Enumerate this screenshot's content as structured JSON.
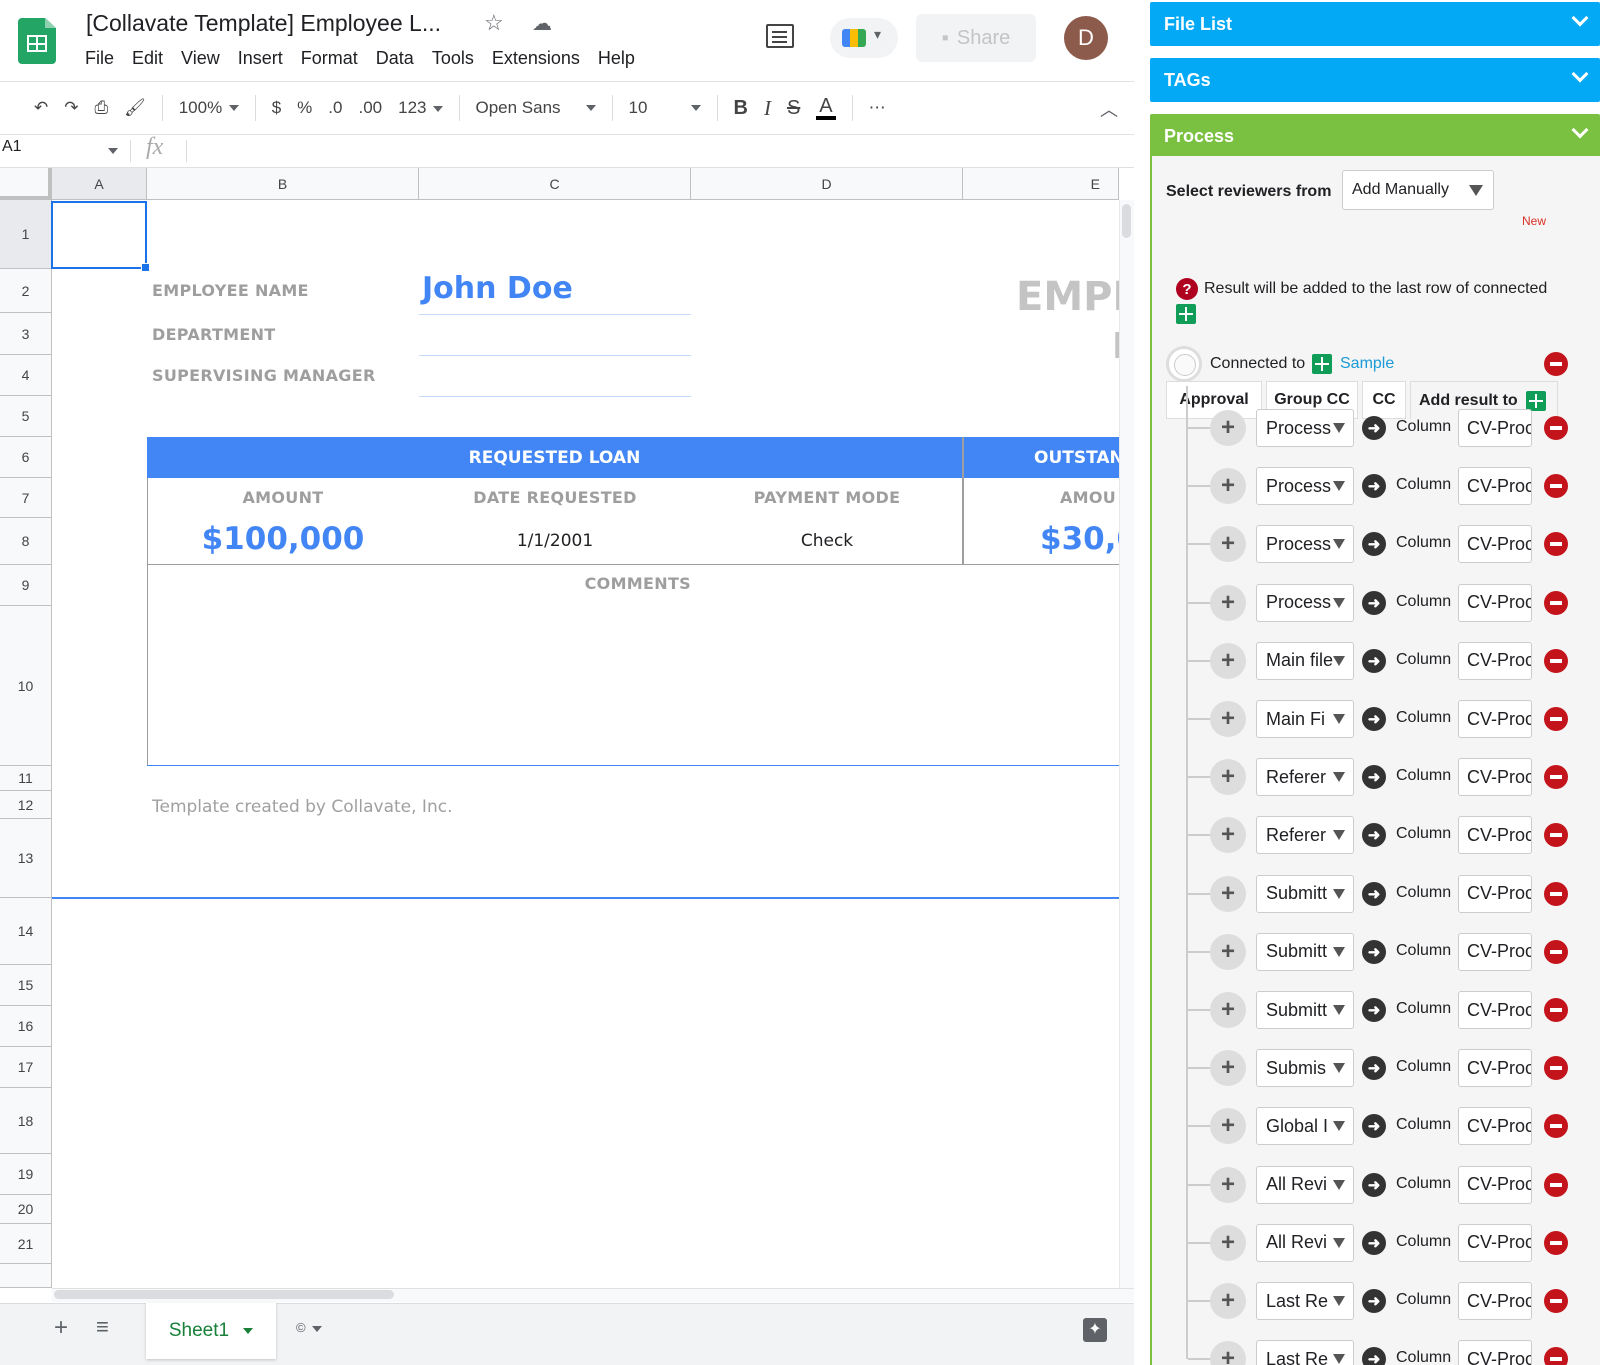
{
  "header": {
    "doc_title": "[Collavate Template] Employee L...",
    "menu": [
      "File",
      "Edit",
      "View",
      "Insert",
      "Format",
      "Data",
      "Tools",
      "Extensions",
      "Help"
    ],
    "share_label": "Share",
    "avatar_letter": "D"
  },
  "toolbar": {
    "zoom": "100%",
    "currency": "$",
    "percent": "%",
    "dec_less": ".0",
    "dec_more": ".00",
    "number_format": "123",
    "font": "Open Sans",
    "font_size": "10",
    "bold": "B",
    "italic": "I",
    "strike": "S",
    "text_color": "A",
    "more": "⋯"
  },
  "formula_bar": {
    "cell_ref": "A1",
    "fx": "fx"
  },
  "columns": [
    "A",
    "B",
    "C",
    "D",
    "E"
  ],
  "rows": [
    "1",
    "2",
    "3",
    "4",
    "5",
    "6",
    "7",
    "8",
    "9",
    "10",
    "11",
    "12",
    "13",
    "14",
    "15",
    "16",
    "17",
    "18",
    "19",
    "20",
    "21"
  ],
  "sheet": {
    "employee_name_label": "EMPLOYEE NAME",
    "employee_name": "John Doe",
    "department_label": "DEPARTMENT",
    "manager_label": "SUPERVISING MANAGER",
    "ghost_title": "EMPL",
    "ghost_sub": "I",
    "requested_loan": "REQUESTED LOAN",
    "outstanding": "OUTSTAN",
    "amount_label": "AMOUNT",
    "date_label": "DATE REQUESTED",
    "mode_label": "PAYMENT MODE",
    "amount2_label": "AMOU",
    "amount": "$100,000",
    "date": "1/1/2001",
    "mode": "Check",
    "amount2": "$30,0",
    "comments": "COMMENTS",
    "credit": "Template created by Collavate, Inc."
  },
  "bottom": {
    "sheet_tab": "Sheet1",
    "add": "+",
    "list": "≡"
  },
  "sidebar": {
    "file_list": "File List",
    "tags": "TAGs",
    "process": "Process",
    "select_reviewers_label": "Select reviewers from",
    "reviewers_value": "Add Manually",
    "tabs": [
      "Approval",
      "Group CC",
      "CC",
      "Add result to"
    ],
    "new_tag": "New",
    "result_note": "Result will be added to the last row of connected",
    "connected_label": "Connected to",
    "connected_sheet": "Sample",
    "column_word": "Column",
    "mappings": [
      {
        "field": "Process",
        "column": "CV-Proc"
      },
      {
        "field": "Process",
        "column": "CV-Proc"
      },
      {
        "field": "Process",
        "column": "CV-Proc"
      },
      {
        "field": "Process",
        "column": "CV-Proc"
      },
      {
        "field": "Main file",
        "column": "CV-Proc"
      },
      {
        "field": "Main Fi",
        "column": "CV-Proc"
      },
      {
        "field": "Referer",
        "column": "CV-Proc"
      },
      {
        "field": "Referer",
        "column": "CV-Proc"
      },
      {
        "field": "Submitt",
        "column": "CV-Proc"
      },
      {
        "field": "Submitt",
        "column": "CV-Proc"
      },
      {
        "field": "Submitt",
        "column": "CV-Proc"
      },
      {
        "field": "Submis",
        "column": "CV-Proc"
      },
      {
        "field": "Global I",
        "column": "CV-Proc"
      },
      {
        "field": "All Revi",
        "column": "CV-Proc"
      },
      {
        "field": "All Revi",
        "column": "CV-Proc"
      },
      {
        "field": "Last Re",
        "column": "CV-Proc"
      },
      {
        "field": "Last Re",
        "column": "CV-Proc"
      }
    ]
  },
  "colors": {
    "file_list": "#03a9f4",
    "tags": "#03a9f4",
    "process": "#7ac142",
    "accent": "#4285f4"
  }
}
